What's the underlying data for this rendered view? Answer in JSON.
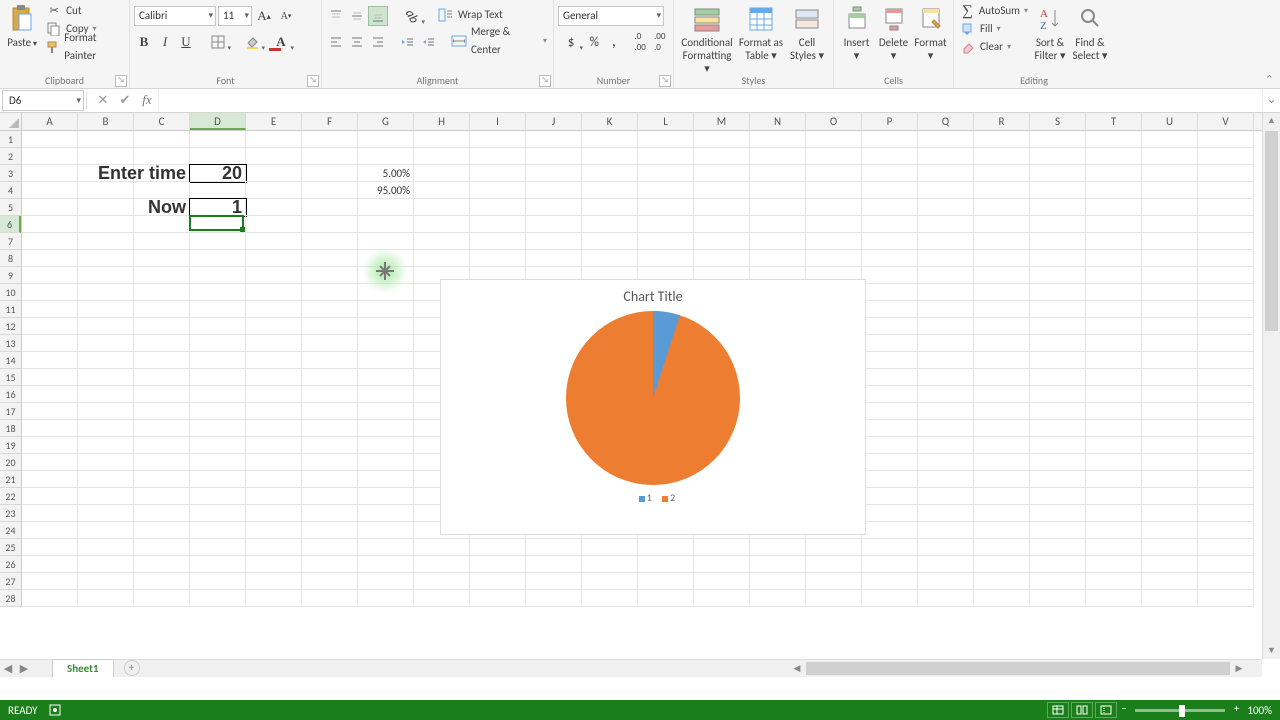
{
  "ribbon": {
    "clipboard": {
      "paste": "Paste",
      "cut": "Cut",
      "copy": "Copy",
      "fmtpaint": "Format Painter",
      "label": "Clipboard"
    },
    "font": {
      "name": "Calibri",
      "size": "11",
      "label": "Font"
    },
    "alignment": {
      "wrap": "Wrap Text",
      "merge": "Merge & Center",
      "label": "Alignment"
    },
    "number": {
      "format": "General",
      "label": "Number"
    },
    "styles": {
      "cond": "Conditional\nFormatting",
      "table": "Format as\nTable",
      "cell": "Cell\nStyles",
      "label": "Styles"
    },
    "cells": {
      "insert": "Insert",
      "delete": "Delete",
      "format": "Format",
      "label": "Cells"
    },
    "editing": {
      "autosum": "AutoSum",
      "fill": "Fill",
      "clear": "Clear",
      "sort": "Sort &\nFilter",
      "find": "Find &\nSelect",
      "label": "Editing"
    }
  },
  "namebox": "D6",
  "formula": "",
  "columns": [
    "A",
    "B",
    "C",
    "D",
    "E",
    "F",
    "G",
    "H",
    "I",
    "J",
    "K",
    "L",
    "M",
    "N",
    "O",
    "P",
    "Q",
    "R",
    "S",
    "T",
    "U",
    "V"
  ],
  "rows": [
    "1",
    "2",
    "3",
    "4",
    "5",
    "6",
    "7",
    "8",
    "9",
    "10",
    "11",
    "12",
    "13",
    "14",
    "15",
    "16",
    "17",
    "18",
    "19",
    "20",
    "21",
    "22",
    "23",
    "24",
    "25",
    "26",
    "27",
    "28"
  ],
  "sel": {
    "col": 3,
    "row": 5
  },
  "cells": {
    "C3": "Enter time",
    "D3": "20",
    "G3": "5.00%",
    "G4": "95.00%",
    "C5": "Now",
    "D5": "1"
  },
  "chart": {
    "title": "Chart Title",
    "legend": [
      "1",
      "2"
    ],
    "colors": [
      "#5b9bd5",
      "#ed7d31"
    ]
  },
  "chart_data": {
    "type": "pie",
    "categories": [
      "1",
      "2"
    ],
    "values": [
      5,
      95
    ],
    "title": "Chart Title",
    "series_colors": [
      "#5b9bd5",
      "#ed7d31"
    ]
  },
  "tabs": {
    "sheet1": "Sheet1"
  },
  "status": {
    "ready": "READY",
    "zoom": "100%"
  }
}
